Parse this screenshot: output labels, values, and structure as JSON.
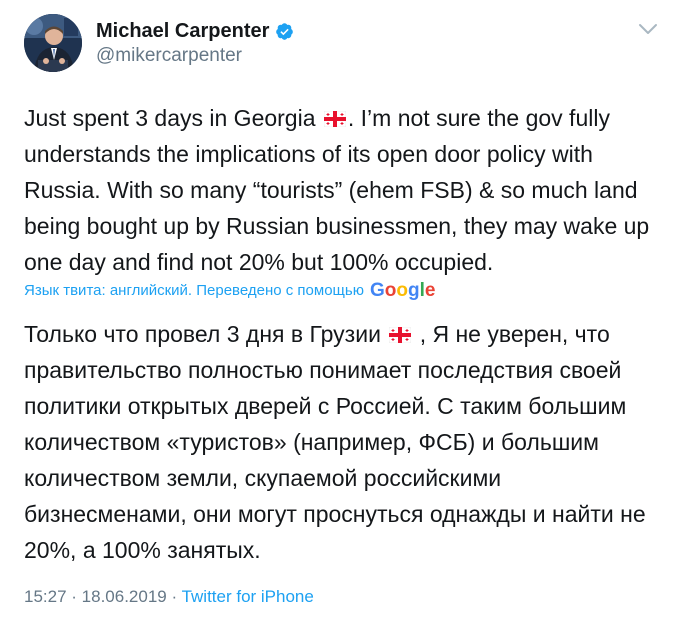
{
  "author": {
    "display_name": "Michael Carpenter",
    "handle": "@mikercarpenter"
  },
  "tweet": {
    "original_lines": [
      {
        "before": "Just spent 3 days in Georgia ",
        "flag": true,
        "after": ". I’m not sure the gov fully"
      },
      {
        "before": "understands the implications of its open door policy with",
        "flag": false,
        "after": ""
      },
      {
        "before": "Russia. With so many “tourists” (ehem FSB) & so much land",
        "flag": false,
        "after": ""
      },
      {
        "before": "being bought up by Russian businessmen, they may wake up",
        "flag": false,
        "after": ""
      },
      {
        "before": "one day and find not 20% but 100% occupied.",
        "flag": false,
        "after": ""
      }
    ],
    "translation_note": "Язык твита: английский. Переведено с помощью",
    "translation_provider": {
      "g1": "G",
      "g2": "o",
      "g3": "o",
      "g4": "g",
      "g5": "l",
      "g6": "e"
    },
    "translated_lines": [
      {
        "before": "Только что провел 3 дня в Грузии ",
        "flag": true,
        "after": " , Я не уверен, что"
      },
      {
        "before": "правительство полностью понимает последствия своей",
        "flag": false,
        "after": ""
      },
      {
        "before": "политики открытых дверей с Россией. С таким большим",
        "flag": false,
        "after": ""
      },
      {
        "before": "количеством «туристов» (например, ФСБ) и большим",
        "flag": false,
        "after": ""
      },
      {
        "before": "количеством земли, скупаемой российскими",
        "flag": false,
        "after": ""
      },
      {
        "before": "бизнесменами, они могут проснуться однажды и найти не",
        "flag": false,
        "after": ""
      },
      {
        "before": "20%, а 100% занятых.",
        "flag": false,
        "after": ""
      }
    ]
  },
  "meta": {
    "time": "15:27",
    "separator": " · ",
    "date": "18.06.2019",
    "source": "Twitter for iPhone"
  },
  "colors": {
    "link": "#1da1f2",
    "secondary_text": "#657786",
    "primary_text": "#14171a",
    "verified_badge": "#1da1f2"
  },
  "icons": {
    "verified": "verified-badge-icon",
    "caret": "chevron-down-icon",
    "flag": "georgia-flag-icon"
  }
}
